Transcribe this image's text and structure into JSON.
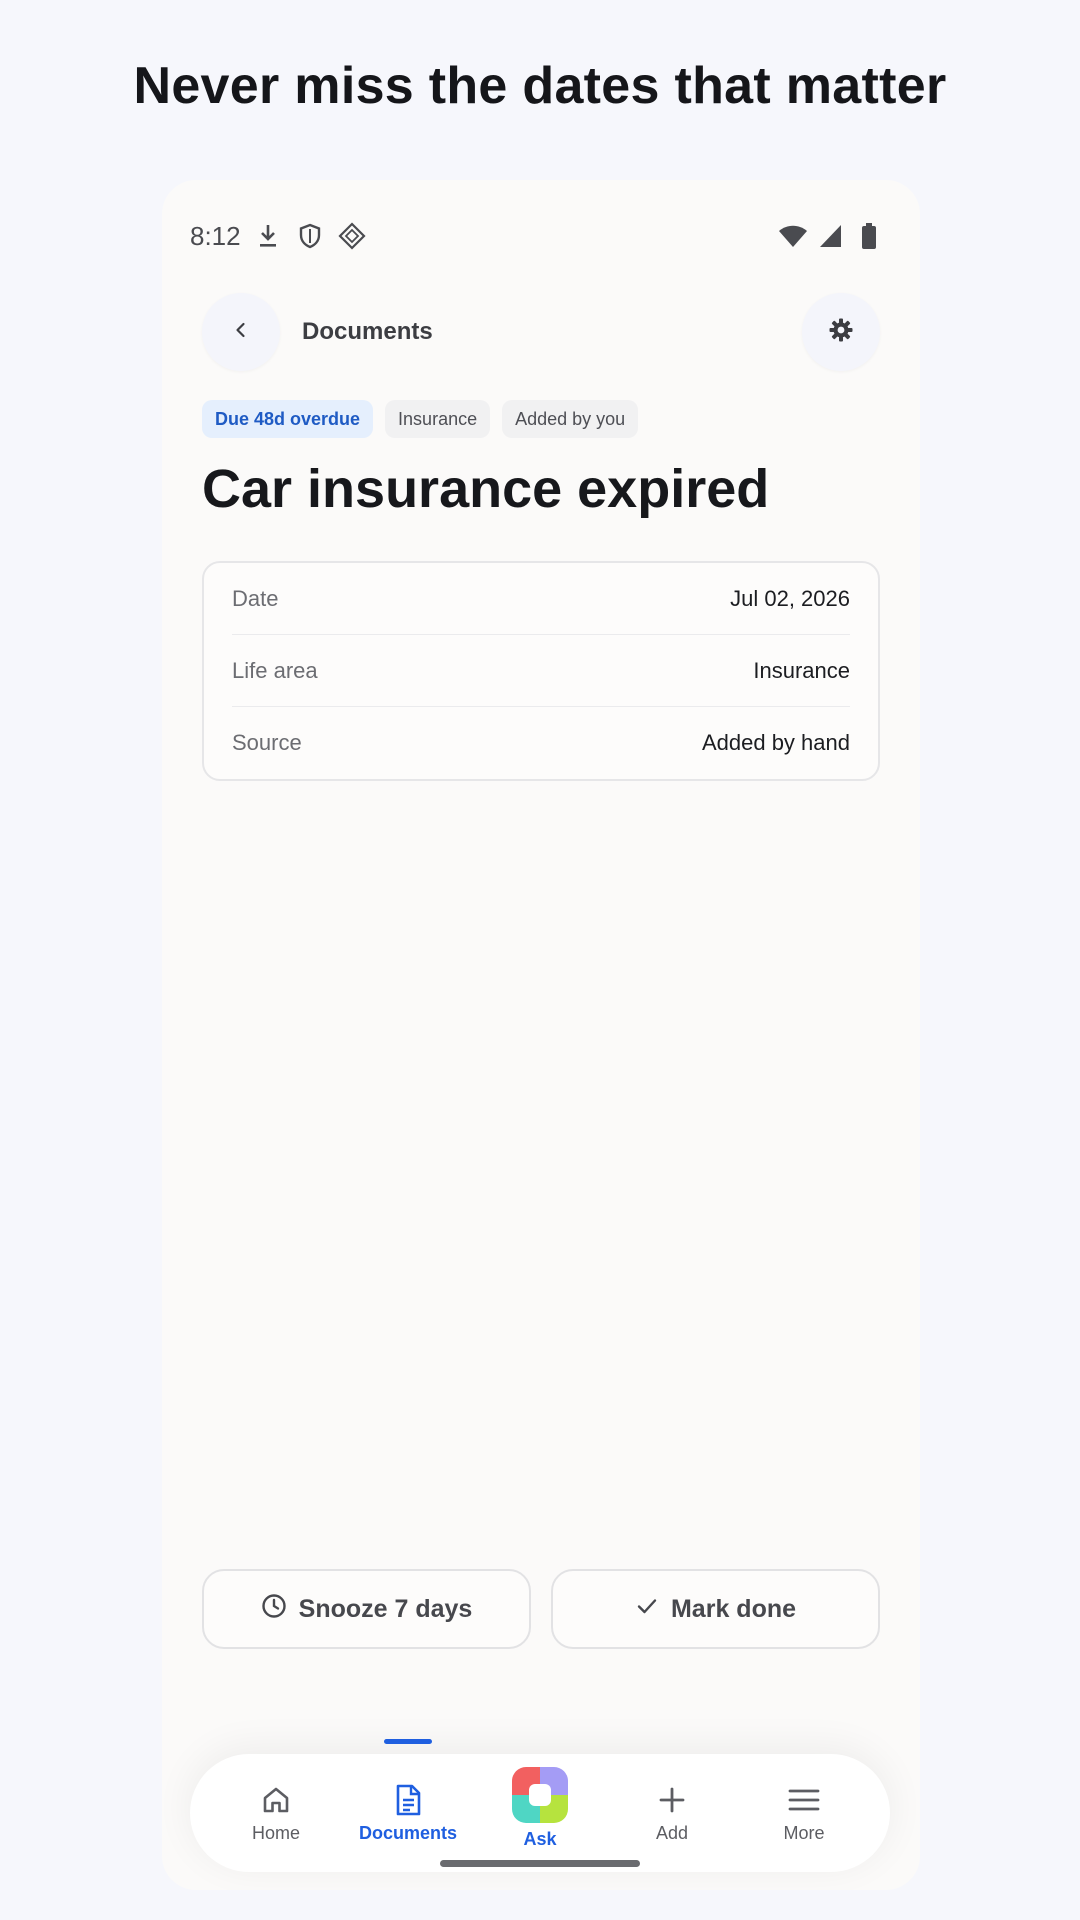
{
  "headline": "Never miss the dates that matter",
  "status_bar": {
    "time": "8:12",
    "icons": [
      "download-icon",
      "shield-icon",
      "diamond-icon",
      "wifi-icon",
      "signal-icon",
      "battery-icon"
    ]
  },
  "topbar": {
    "title": "Documents",
    "back_icon": "chevron-left-icon",
    "settings_icon": "gear-icon"
  },
  "chips": [
    {
      "label": "Due 48d overdue",
      "style": "primary"
    },
    {
      "label": "Insurance",
      "style": "neutral"
    },
    {
      "label": "Added by you",
      "style": "neutral"
    }
  ],
  "title": "Car insurance expired",
  "details": [
    {
      "label": "Date",
      "value": "Jul 02, 2026"
    },
    {
      "label": "Life area",
      "value": "Insurance"
    },
    {
      "label": "Source",
      "value": "Added by hand"
    }
  ],
  "actions": {
    "snooze_label": "Snooze 7 days",
    "done_label": "Mark done"
  },
  "nav": {
    "items": [
      {
        "label": "Home",
        "icon": "home-icon"
      },
      {
        "label": "Documents",
        "icon": "document-icon",
        "active": true
      },
      {
        "label": "Ask",
        "icon": "ask-logo-icon"
      },
      {
        "label": "Add",
        "icon": "plus-icon"
      },
      {
        "label": "More",
        "icon": "menu-icon"
      }
    ]
  },
  "colors": {
    "accent": "#1f5fe0",
    "chip_primary_bg": "#e5effd",
    "background": "#f6f7fc"
  }
}
